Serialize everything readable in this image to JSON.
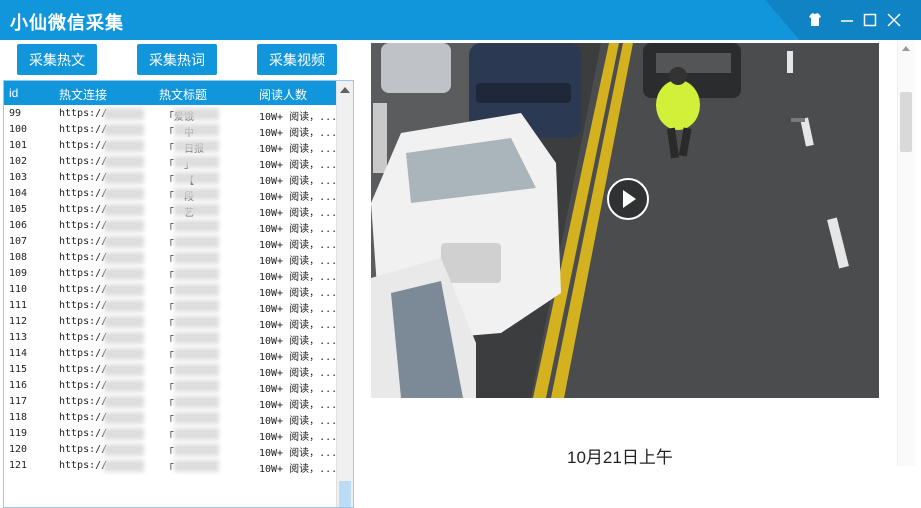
{
  "app": {
    "title": "小仙微信采集",
    "accent": "#1296db",
    "controls": [
      "skin-icon",
      "minimize-icon",
      "maximize-icon",
      "close-icon"
    ]
  },
  "toolbar": {
    "articles_label": "采集热文",
    "words_label": "采集热词",
    "videos_label": "采集视频"
  },
  "table": {
    "columns": [
      "id",
      "热文连接",
      "热文标题",
      "阅读人数"
    ],
    "rows": [
      {
        "id": "99",
        "link": "https://",
        "title": "「爱",
        "title2": "饿",
        "reads": "10W+ 阅读，..."
      },
      {
        "id": "100",
        "link": "https://",
        "title": "「",
        "title2": "中",
        "reads": "10W+ 阅读，..."
      },
      {
        "id": "101",
        "link": "https://",
        "title": "「",
        "title2": "日报",
        "reads": "10W+ 阅读，..."
      },
      {
        "id": "102",
        "link": "https://",
        "title": "「",
        "title2": "」",
        "reads": "10W+ 阅读，..."
      },
      {
        "id": "103",
        "link": "https://",
        "title": "「",
        "title2": "【",
        "reads": "10W+ 阅读，..."
      },
      {
        "id": "104",
        "link": "https://",
        "title": "「",
        "title2": "段",
        "reads": "10W+ 阅读，..."
      },
      {
        "id": "105",
        "link": "https://",
        "title": "「",
        "title2": "艺",
        "reads": "10W+ 阅读，..."
      },
      {
        "id": "106",
        "link": "https://",
        "title": "「",
        "title2": "",
        "reads": "10W+ 阅读，..."
      },
      {
        "id": "107",
        "link": "https://",
        "title": "「",
        "title2": "",
        "reads": "10W+ 阅读，..."
      },
      {
        "id": "108",
        "link": "https://",
        "title": "「",
        "title2": "",
        "reads": "10W+ 阅读，..."
      },
      {
        "id": "109",
        "link": "https://",
        "title": "「",
        "title2": "",
        "reads": "10W+ 阅读，..."
      },
      {
        "id": "110",
        "link": "https://",
        "title": "「",
        "title2": "",
        "reads": "10W+ 阅读，..."
      },
      {
        "id": "111",
        "link": "https://",
        "title": "「",
        "title2": "",
        "reads": "10W+ 阅读，..."
      },
      {
        "id": "112",
        "link": "https://",
        "title": "「",
        "title2": "",
        "reads": "10W+ 阅读，..."
      },
      {
        "id": "113",
        "link": "https://",
        "title": "「",
        "title2": "",
        "reads": "10W+ 阅读，..."
      },
      {
        "id": "114",
        "link": "https://",
        "title": "「",
        "title2": "",
        "reads": "10W+ 阅读，..."
      },
      {
        "id": "115",
        "link": "https://",
        "title": "「",
        "title2": "",
        "reads": "10W+ 阅读，..."
      },
      {
        "id": "116",
        "link": "https://",
        "title": "「",
        "title2": "",
        "reads": "10W+ 阅读，..."
      },
      {
        "id": "117",
        "link": "https://",
        "title": "「",
        "title2": "",
        "reads": "10W+ 阅读，..."
      },
      {
        "id": "118",
        "link": "https://",
        "title": "「",
        "title2": "",
        "reads": "10W+ 阅读，..."
      },
      {
        "id": "119",
        "link": "https://",
        "title": "「",
        "title2": "",
        "reads": "10W+ 阅读，..."
      },
      {
        "id": "120",
        "link": "https://",
        "title": "「",
        "title2": "",
        "reads": "10W+ 阅读，..."
      },
      {
        "id": "121",
        "link": "https://",
        "title": "「",
        "title2": "",
        "reads": "10W+ 阅读，..."
      }
    ]
  },
  "video": {
    "caption": "10月21日上午",
    "play_icon": "play-icon"
  }
}
